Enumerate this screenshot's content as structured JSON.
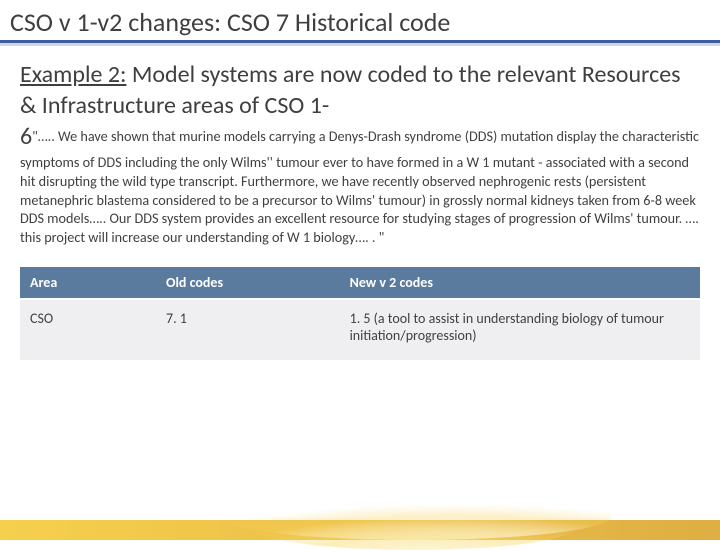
{
  "title": "CSO v 1-v2 changes: CSO 7 Historical code",
  "example": {
    "label": "Example 2:",
    "heading_rest": " Model systems are now coded to the relevant Resources & Infrastructure areas of CSO 1-",
    "leadnum": "6",
    "body": "\"….. We have shown that murine models carrying a Denys-Drash syndrome (DDS) mutation display the characteristic symptoms of DDS including the only Wilms'' tumour ever to have formed in a W 1 mutant - associated with a second hit disrupting the wild type transcript. Furthermore, we have recently observed nephrogenic rests (persistent metanephric blastema considered to be a precursor to Wilms' tumour) in grossly normal kidneys taken from 6-8 week DDS models….. Our DDS system provides an excellent resource for studying stages of progression of Wilms' tumour. …. this project will increase our understanding of W 1 biology…. . \""
  },
  "table": {
    "headers": {
      "area": "Area",
      "old": "Old codes",
      "new": "New v 2 codes"
    },
    "row": {
      "area": "CSO",
      "old": "7. 1",
      "new": "1. 5 (a tool to assist in understanding biology of tumour initiation/progression)"
    }
  }
}
